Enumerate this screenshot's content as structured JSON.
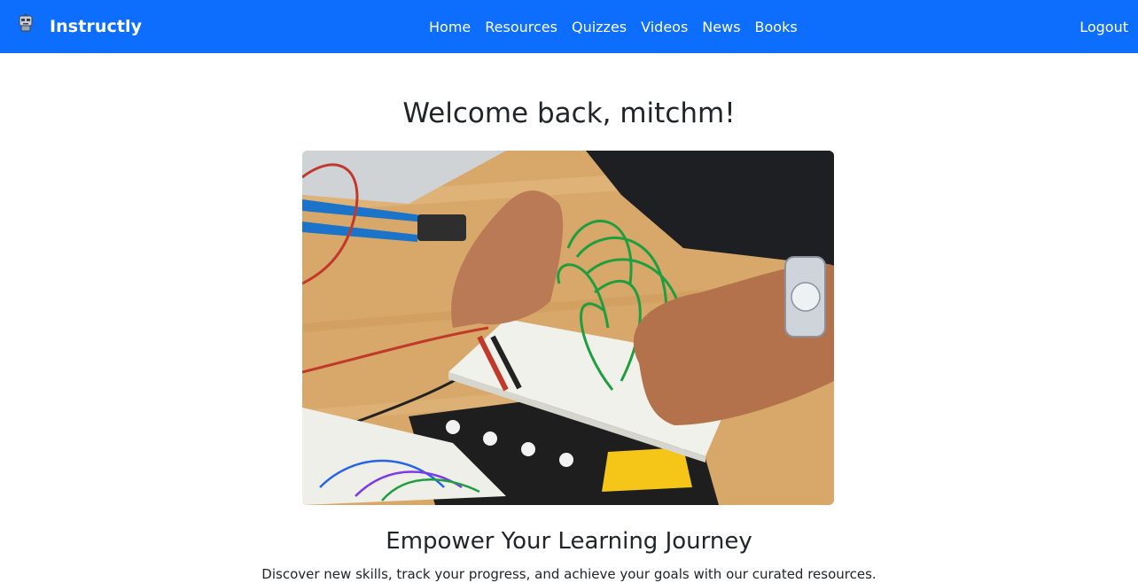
{
  "navbar": {
    "brand": "Instructly",
    "brand_icon": "robot-icon",
    "links": [
      {
        "label": "Home"
      },
      {
        "label": "Resources"
      },
      {
        "label": "Quizzes"
      },
      {
        "label": "Videos"
      },
      {
        "label": "News"
      },
      {
        "label": "Books"
      }
    ],
    "logout": "Logout",
    "bg_color": "#0d6efd"
  },
  "main": {
    "welcome": "Welcome back, mitchm!",
    "hero_alt": "hands-wiring-breadboard-photo",
    "tagline": "Empower Your Learning Journey",
    "subtext": "Discover new skills, track your progress, and achieve your goals with our curated resources."
  }
}
